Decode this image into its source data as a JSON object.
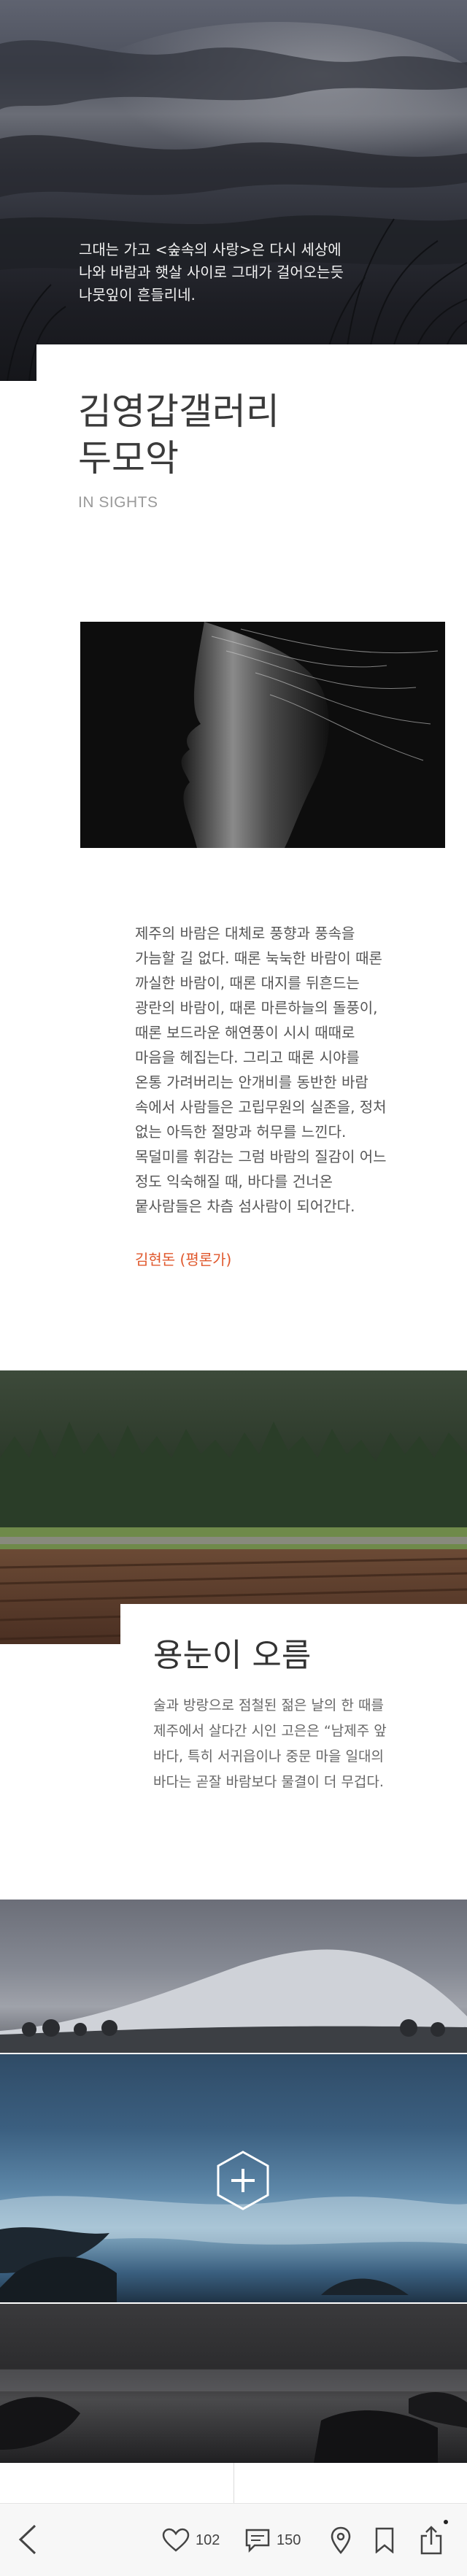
{
  "hero": {
    "caption_lines": [
      "그대는 가고 <숲속의 사랑>은 다시 세상에",
      "나와 바람과 햇살 사이로 그대가 걸어오는듯",
      "나뭇잎이 흔들리네."
    ]
  },
  "gallery": {
    "title_line1": "김영갑갤러리",
    "title_line2": "두모악",
    "subtitle": "IN SIGHTS"
  },
  "essay": {
    "lines": [
      "제주의 바람은 대체로 풍향과 풍속을",
      "가늠할 길 없다. 때론 눅눅한 바람이 때론",
      "까실한 바람이, 때론 대지를 뒤흔드는",
      "광란의 바람이, 때론 마른하늘의 돌풍이,",
      "때론 보드라운 해연풍이 시시 때때로",
      "마음을 헤집는다. 그리고 때론 시야를",
      "온통 가려버리는 안개비를 동반한 바람",
      "속에서 사람들은 고립무원의 실존을, 정처",
      "없는 아득한 절망과 허무를 느낀다.",
      "목덜미를 휘감는 그럼 바람의 질감이 어느",
      "정도 익숙해질 때, 바다를 건너온",
      "뭍사람들은 차츰 섬사람이 되어간다."
    ],
    "author": "김현돈 (평론가)"
  },
  "oreum": {
    "title": "용눈이 오름",
    "lines": [
      "술과 방랑으로 점철된 젊은 날의 한 때를",
      "제주에서 살다간 시인 고은은 “남제주 앞",
      "바다, 특히 서귀읍이나 중문 마을 일대의",
      "바다는 곧잘 바람보다 물결이 더 무겁다."
    ]
  },
  "toolbar": {
    "like_count": "102",
    "comment_count": "150"
  },
  "colors": {
    "accent": "#e0572b",
    "title": "#3a3a3a",
    "subtitle": "#9a9a9a"
  },
  "icons": [
    "back-icon",
    "heart-icon",
    "comment-icon",
    "location-pin-icon",
    "bookmark-icon",
    "share-icon",
    "plus-hexagon-icon"
  ]
}
